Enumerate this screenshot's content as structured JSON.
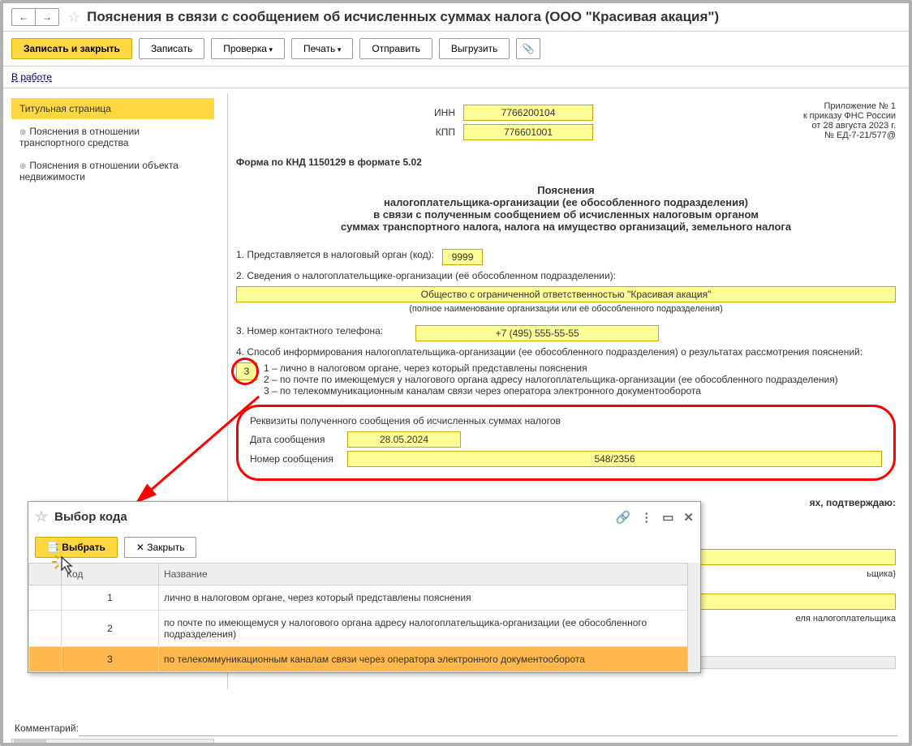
{
  "titlebar": {
    "title": "Пояснения в связи с сообщением об исчисленных суммах налога (ООО \"Красивая акация\")"
  },
  "toolbar": {
    "save_close": "Записать и закрыть",
    "save": "Записать",
    "check": "Проверка",
    "print": "Печать",
    "send": "Отправить",
    "export": "Выгрузить"
  },
  "status": "В работе",
  "sidebar": {
    "items": [
      {
        "label": "Титульная страница",
        "active": true
      },
      {
        "label": "Пояснения в отношении транспортного средства",
        "expandable": true
      },
      {
        "label": "Пояснения в отношении объекта недвижимости",
        "expandable": true
      }
    ]
  },
  "form": {
    "attachment_info": [
      "Приложение № 1",
      "к приказу ФНС России",
      "от 28 августа 2023 г.",
      "№ ЕД-7-21/577@"
    ],
    "inn_label": "ИНН",
    "inn": "7766200104",
    "kpp_label": "КПП",
    "kpp": "776601001",
    "form_code": "Форма по КНД 1150129 в формате 5.02",
    "title_lines": [
      "Пояснения",
      "налогоплательщика-организации (ее обособленного подразделения)",
      "в связи с полученным сообщением об исчисленных налоговым органом",
      "суммах транспортного налога, налога на имущество организаций, земельного налога"
    ],
    "sec1_label": "1. Представляется в налоговый орган (код):",
    "tax_code": "9999",
    "sec2_label": "2. Сведения о налогоплательщике-организации (её обособленном подразделении):",
    "org_name": "Общество с ограниченной ответственностью \"Красивая акация\"",
    "org_hint": "(полное наименование организации или её обособленного подразделения)",
    "sec3_label": "3. Номер контактного телефона:",
    "phone": "+7 (495) 555-55-55",
    "sec4_label": "4. Способ информирования налогоплательщика-организации (ее обособленного подразделения) о результатах рассмотрения пояснений:",
    "method_code": "3",
    "method_options": [
      "1 – лично в налоговом органе, через который представлены пояснения",
      "2 – по почте по имеющемуся у налогового органа адресу налогоплательщика-организации (ее обособленного подразделения)",
      "3 – по телекоммуникационным каналам связи через оператора электронного документооборота"
    ],
    "req_title": "Реквизиты полученного сообщения об исчисленных суммах налогов",
    "msg_date_label": "Дата сообщения",
    "msg_date": "28.05.2024",
    "msg_num_label": "Номер сообщения",
    "msg_num": "548/2356",
    "confirm_tail": "ях, подтверждаю:",
    "sig_hint1": "ьщика)",
    "sig_hint2": "еля налогоплательщика"
  },
  "modal": {
    "title": "Выбор кода",
    "select_btn": "Выбрать",
    "close_btn": "Закрыть",
    "col_code": "Код",
    "col_name": "Название",
    "rows": [
      {
        "code": "1",
        "name": "лично в налоговом органе, через который представлены пояснения"
      },
      {
        "code": "2",
        "name": "по почте по имеющемуся у налогового органа адресу налогоплательщика-организации (ее обособленного подразделения)"
      },
      {
        "code": "3",
        "name": "по телекоммуникационным каналам связи через оператора электронного документооборота"
      }
    ]
  },
  "comment_label": "Комментарий:"
}
